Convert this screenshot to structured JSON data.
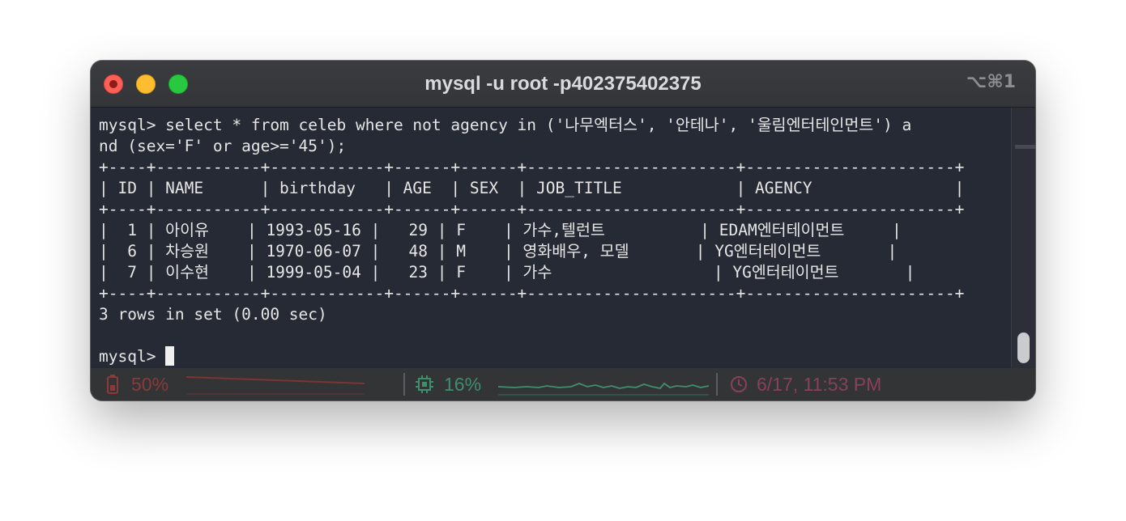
{
  "window": {
    "title": "mysql -u root -p402375402375",
    "shortcut": "⌥⌘1"
  },
  "terminal": {
    "lines": [
      "mysql> select * from celeb where not agency in ('나무엑터스', '안테나', '울림엔터테인먼트') a",
      "nd (sex='F' or age>='45');",
      "+----+-----------+------------+------+------+----------------------+----------------------+",
      "| ID | NAME      | birthday   | AGE  | SEX  | JOB_TITLE            | AGENCY               |",
      "+----+-----------+------------+------+------+----------------------+----------------------+",
      "|  1 | 아이유    | 1993-05-16 |   29 | F    | 가수,텔런트          | EDAM엔터테이먼트     |",
      "|  6 | 차승원    | 1970-06-07 |   48 | M    | 영화배우, 모델       | YG엔터테이먼트       |",
      "|  7 | 이수현    | 1999-05-04 |   23 | F    | 가수                 | YG엔터테이먼트       |",
      "+----+-----------+------------+------+------+----------------------+----------------------+",
      "3 rows in set (0.00 sec)",
      ""
    ],
    "prompt": "mysql> "
  },
  "query": {
    "command": "select * from celeb where not agency in ('나무엑터스', '안테나', '울림엔터테인먼트') and (sex='F' or age>='45');",
    "columns": [
      "ID",
      "NAME",
      "birthday",
      "AGE",
      "SEX",
      "JOB_TITLE",
      "AGENCY"
    ],
    "rows": [
      [
        "1",
        "아이유",
        "1993-05-16",
        "29",
        "F",
        "가수,텔런트",
        "EDAM엔터테이먼트"
      ],
      [
        "6",
        "차승원",
        "1970-06-07",
        "48",
        "M",
        "영화배우, 모델",
        "YG엔터테이먼트"
      ],
      [
        "7",
        "이수현",
        "1999-05-04",
        "23",
        "F",
        "가수",
        "YG엔터테이먼트"
      ]
    ],
    "summary": "3 rows in set (0.00 sec)"
  },
  "statusbar": {
    "battery": {
      "label": "50%",
      "color": "#8b3a3a",
      "icon": "battery-icon"
    },
    "cpu": {
      "label": "16%",
      "color": "#3f8f6f",
      "icon": "cpu-chip-icon"
    },
    "clock": {
      "label": "6/17, 11:53 PM",
      "color": "#8a3f5a",
      "icon": "clock-icon"
    }
  },
  "colors": {
    "terminal_bg": "#262a34",
    "terminal_fg": "#e6e6e6",
    "close": "#fe5f57",
    "minimize": "#febc2e",
    "maximize": "#28c840"
  }
}
